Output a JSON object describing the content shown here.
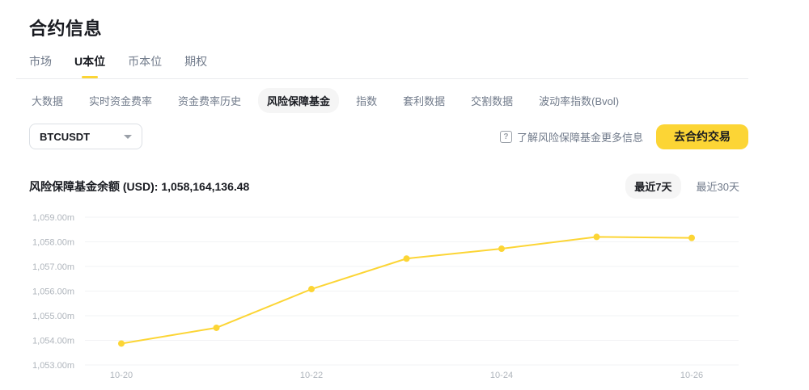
{
  "page": {
    "title": "合约信息"
  },
  "main_tabs": {
    "items": [
      {
        "label": "市场",
        "active": false
      },
      {
        "label": "U本位",
        "active": true
      },
      {
        "label": "币本位",
        "active": false
      },
      {
        "label": "期权",
        "active": false
      }
    ]
  },
  "sub_tabs": {
    "items": [
      {
        "label": "大数据",
        "active": false
      },
      {
        "label": "实时资金费率",
        "active": false
      },
      {
        "label": "资金费率历史",
        "active": false
      },
      {
        "label": "风险保障基金",
        "active": true
      },
      {
        "label": "指数",
        "active": false
      },
      {
        "label": "套利数据",
        "active": false
      },
      {
        "label": "交割数据",
        "active": false
      },
      {
        "label": "波动率指数(Bvol)",
        "active": false
      }
    ]
  },
  "controls": {
    "symbol_select": {
      "value": "BTCUSDT"
    },
    "info_link": {
      "label": "了解风险保障基金更多信息",
      "icon": "question-icon"
    },
    "trade_button": {
      "label": "去合约交易"
    }
  },
  "chart_header": {
    "title": "风险保障基金余额 (USD): 1,058,164,136.48",
    "range_toggle": [
      {
        "label": "最近7天",
        "active": true
      },
      {
        "label": "最近30天",
        "active": false
      }
    ]
  },
  "colors": {
    "accent_yellow": "#FCD535",
    "text_primary": "#181A20",
    "text_secondary": "#707A8A",
    "axis_label": "#AFB5BC",
    "grid_line": "#F2F3F5"
  },
  "chart_data": {
    "type": "line",
    "title": "风险保障基金余额 (USD): 1,058,164,136.48",
    "series_name": "风险保障基金余额",
    "x": [
      "10-20",
      "10-21",
      "10-22",
      "10-23",
      "10-24",
      "10-25",
      "10-26"
    ],
    "x_tick_indices": [
      0,
      2,
      4,
      6
    ],
    "values_millions_usd": [
      1053.87,
      1054.51,
      1056.08,
      1057.32,
      1057.72,
      1058.2,
      1058.16
    ],
    "y_ticks": [
      {
        "label": "1,059.00m",
        "value": 1059
      },
      {
        "label": "1,058.00m",
        "value": 1058
      },
      {
        "label": "1,057.00m",
        "value": 1057
      },
      {
        "label": "1,056.00m",
        "value": 1056
      },
      {
        "label": "1,055.00m",
        "value": 1055
      },
      {
        "label": "1,054.00m",
        "value": 1054
      },
      {
        "label": "1,053.00m",
        "value": 1053
      }
    ],
    "ylim": [
      1053,
      1059
    ],
    "grid": true,
    "legend_position": "none",
    "line_color": "#FCD535"
  }
}
